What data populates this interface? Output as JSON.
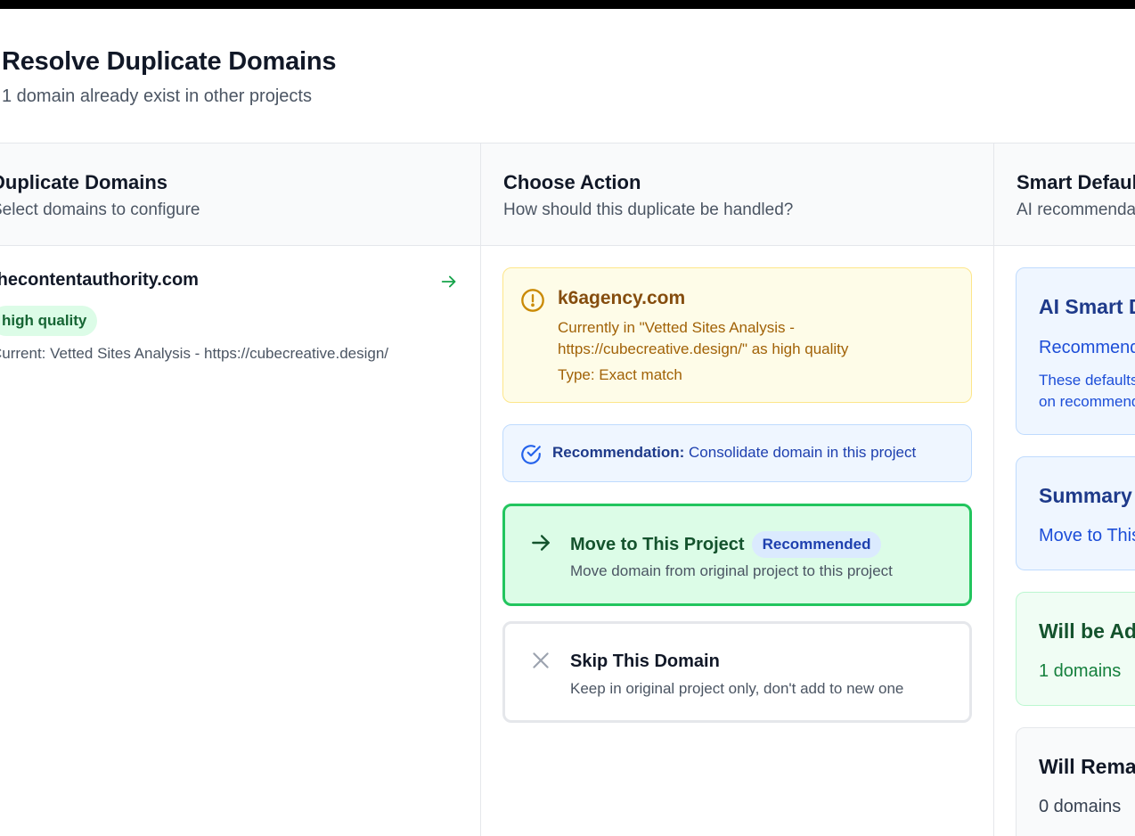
{
  "modal": {
    "title": "Resolve Duplicate Domains",
    "subtitle": "1 domain already exist in other projects"
  },
  "columns": {
    "duplicates": {
      "title": "Duplicate Domains",
      "subtitle": "Select domains to configure"
    },
    "action": {
      "title": "Choose Action",
      "subtitle": "How should this duplicate be handled?"
    },
    "defaults": {
      "title": "Smart Defaults",
      "subtitle": "AI recommendations"
    }
  },
  "domain_list": [
    {
      "name": "thecontentauthority.com",
      "quality": "high quality",
      "current": "Current: Vetted Sites Analysis - https://cubecreative.design/"
    }
  ],
  "warning": {
    "domain": "k6agency.com",
    "body": "Currently in \"Vetted Sites Analysis - https://cubecreative.design/\" as high quality",
    "type": "Type: Exact match"
  },
  "recommendation": {
    "label": "Recommendation:",
    "text": "Consolidate domain in this project"
  },
  "options": {
    "move": {
      "title": "Move to This Project",
      "badge": "Recommended",
      "desc": "Move domain from original project to this project"
    },
    "skip": {
      "title": "Skip This Domain",
      "desc": "Keep in original project only, don't add to new one"
    }
  },
  "side": {
    "ai": {
      "title": "AI Smart Defaults",
      "line": "Recommended",
      "small": "These defaults are based on recommended actions"
    },
    "summary": {
      "title": "Summary",
      "line": "Move to This Project"
    },
    "added": {
      "title": "Will be Added",
      "line": "1 domains"
    },
    "remain": {
      "title": "Will Remain",
      "line": "0 domains"
    }
  },
  "colors": {
    "accent_green": "#22c55e",
    "accent_blue": "#1e40af",
    "warning": "#a16207"
  }
}
